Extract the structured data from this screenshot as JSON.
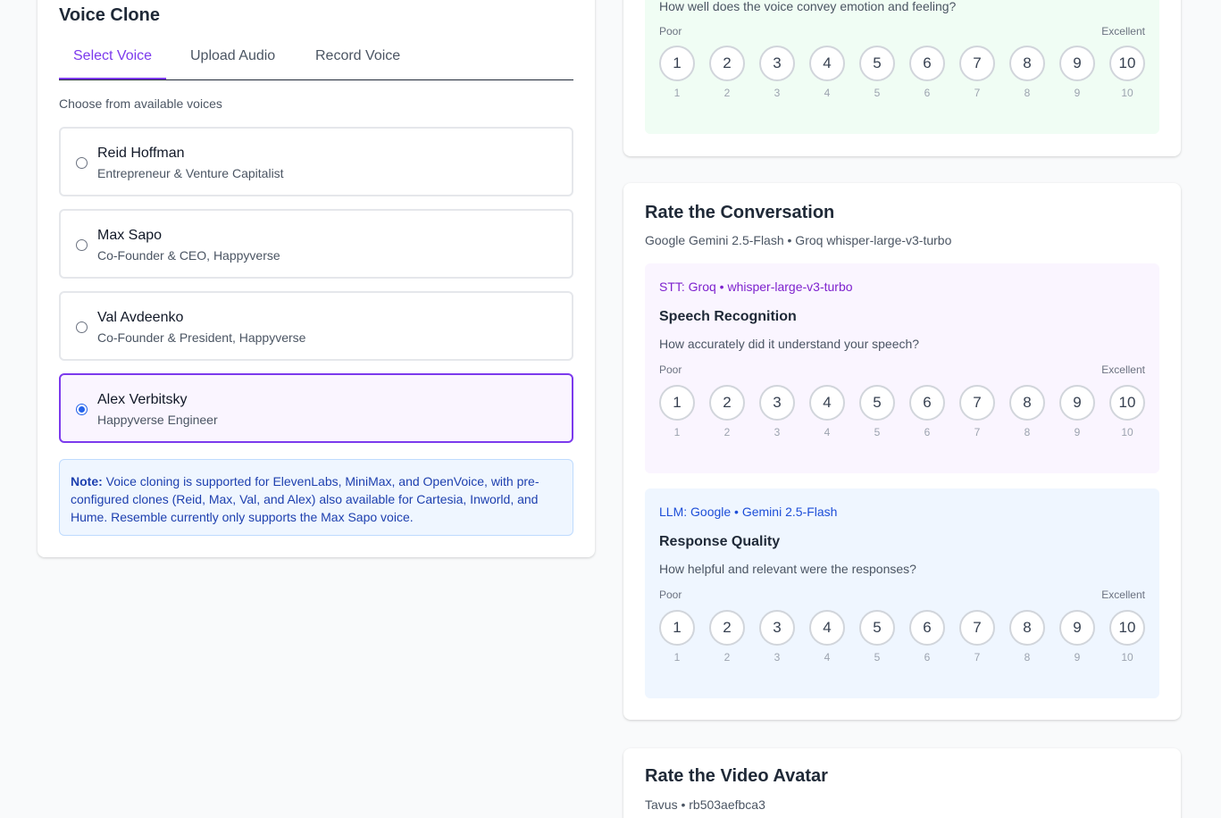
{
  "voice_clone": {
    "title": "Voice Clone",
    "tabs": [
      {
        "label": "Select Voice",
        "active": true
      },
      {
        "label": "Upload Audio",
        "active": false
      },
      {
        "label": "Record Voice",
        "active": false
      }
    ],
    "choose_label": "Choose from available voices",
    "voices": [
      {
        "name": "Reid Hoffman",
        "desc": "Entrepreneur & Venture Capitalist",
        "selected": false
      },
      {
        "name": "Max Sapo",
        "desc": "Co-Founder & CEO, Happyverse",
        "selected": false
      },
      {
        "name": "Val Avdeenko",
        "desc": "Co-Founder & President, Happyverse",
        "selected": false
      },
      {
        "name": "Alex Verbitsky",
        "desc": "Happyverse Engineer",
        "selected": true
      }
    ],
    "note_label": "Note:",
    "note_text": " Voice cloning is supported for ElevenLabs, MiniMax, and OpenVoice, with pre-configured clones (Reid, Max, Val, and Alex) also available for Cartesia, Inworld, and Hume. Resemble currently only supports the Max Sapo voice."
  },
  "tts_rating": {
    "question": "How well does the voice convey emotion and feeling?",
    "low_label": "Poor",
    "high_label": "Excellent"
  },
  "conversation": {
    "title": "Rate the Conversation",
    "subtitle": "Google Gemini 2.5-Flash • Groq whisper-large-v3-turbo",
    "stt": {
      "service": "STT: Groq • whisper-large-v3-turbo",
      "metric": "Speech Recognition",
      "question": "How accurately did it understand your speech?",
      "low_label": "Poor",
      "high_label": "Excellent"
    },
    "llm": {
      "service": "LLM: Google • Gemini 2.5-Flash",
      "metric": "Response Quality",
      "question": "How helpful and relevant were the responses?",
      "low_label": "Poor",
      "high_label": "Excellent"
    }
  },
  "video_avatar": {
    "title": "Rate the Video Avatar",
    "subtitle": "Tavus • rb503aefbca3"
  },
  "rating_scale": [
    "1",
    "2",
    "3",
    "4",
    "5",
    "6",
    "7",
    "8",
    "9",
    "10"
  ],
  "colors": {
    "accent": "#7c3aed",
    "note_bg": "#eff6ff",
    "note_text": "#1e40af",
    "stt_bg": "#faf5ff",
    "llm_bg": "#eff6ff",
    "tts_bg": "#f0fdf4"
  }
}
